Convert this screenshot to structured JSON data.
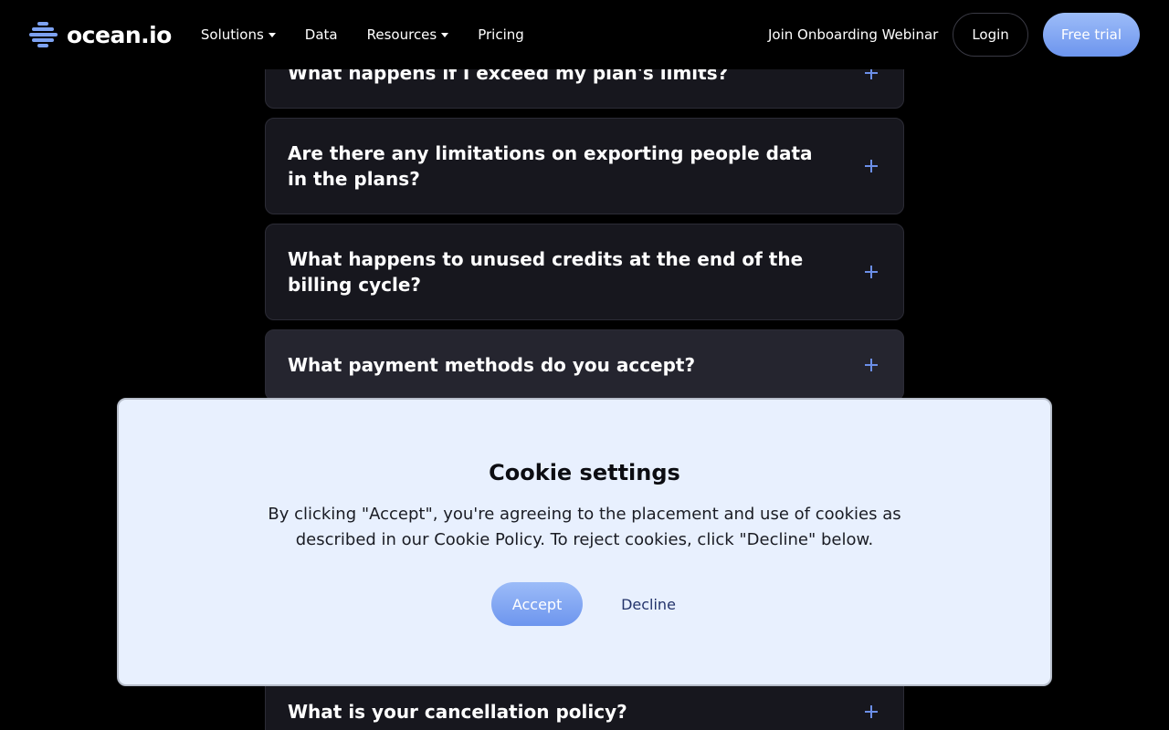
{
  "header": {
    "logo_text": "ocean.io",
    "nav": [
      {
        "label": "Solutions",
        "has_dropdown": true
      },
      {
        "label": "Data",
        "has_dropdown": false
      },
      {
        "label": "Resources",
        "has_dropdown": true
      },
      {
        "label": "Pricing",
        "has_dropdown": false
      }
    ],
    "webinar_label": "Join Onboarding Webinar",
    "login_label": "Login",
    "trial_label": "Free trial"
  },
  "faq": [
    {
      "question": "What happens if I exceed my plan's limits?"
    },
    {
      "question": "Are there any limitations on exporting people data in the plans?"
    },
    {
      "question": "What happens to unused credits at the end of the billing cycle?"
    },
    {
      "question": "What payment methods do you accept?"
    },
    {
      "question": "What is your cancellation policy?"
    }
  ],
  "cookie": {
    "title": "Cookie settings",
    "text": "By clicking \"Accept\", you're agreeing to the placement and use of cookies as described in our Cookie Policy. To reject cookies, click \"Decline\" below.",
    "accept_label": "Accept",
    "decline_label": "Decline"
  },
  "colors": {
    "background": "#000000",
    "card": "#17171e",
    "accent": "#6c8fe8",
    "modal": "#e8f0fe"
  }
}
